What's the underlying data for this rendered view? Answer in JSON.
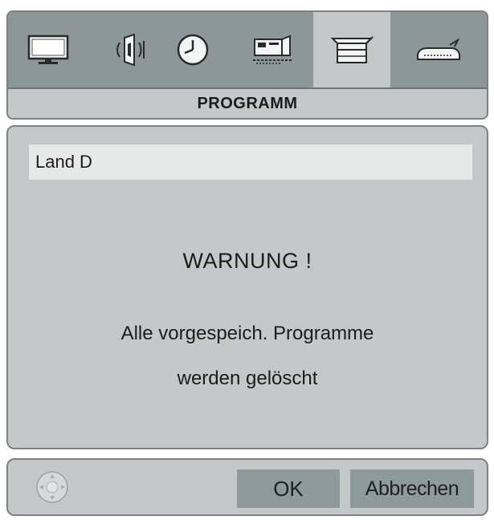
{
  "menu": {
    "title": "PROGRAMM",
    "icons": [
      {
        "name": "picture",
        "icon": "tv-icon",
        "active": false
      },
      {
        "name": "sound",
        "icon": "speaker-icon",
        "active": false
      },
      {
        "name": "timer",
        "icon": "clock-icon",
        "active": false
      },
      {
        "name": "function",
        "icon": "settings-device-icon",
        "active": false
      },
      {
        "name": "program",
        "icon": "channel-list-icon",
        "active": true
      },
      {
        "name": "source",
        "icon": "input-source-icon",
        "active": false
      }
    ]
  },
  "content": {
    "country": "Land D",
    "warning_title": "WARNUNG !",
    "warning_line1": "Alle vorgespeich. Programme",
    "warning_line2": "werden gelöscht"
  },
  "buttons": {
    "ok_label": "OK",
    "cancel_label": "Abbrechen"
  },
  "colors": {
    "panel": "#c4c8c9",
    "icon_bar": "#8b9798",
    "field": "#e7e8e8",
    "button": "#8e9b9d",
    "border": "#7c8283"
  }
}
